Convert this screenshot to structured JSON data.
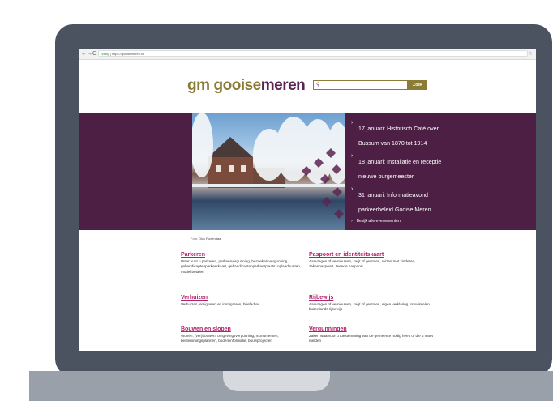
{
  "browser": {
    "back": "←",
    "forward": "→",
    "reload": "C",
    "lock": "🔒",
    "secure_label": "Veilig",
    "url": "https://gooisemeren.nl",
    "bookmark_star": "☆"
  },
  "header": {
    "logo_gm": "gm",
    "logo_name_part1": "gooise",
    "logo_name_part2": "meren",
    "search_placeholder": "",
    "search_icon": "search-icon",
    "search_button_label": "Zoek"
  },
  "hero": {
    "events": [
      {
        "label": "17 januari: Historisch Café over Bussum van 1870 tot 1914"
      },
      {
        "label": "18 januari: Installatie en receptie nieuwe burgemeester"
      },
      {
        "label": "31 januari: Informatieavond parkeerbeleid Gooise Meren"
      }
    ],
    "all_events_label": "Bekijk alle evenementen",
    "photo_caption_prefix": "Foto:",
    "photo_caption_author": "Dick Rozendaal"
  },
  "topics": [
    {
      "title": "Parkeren",
      "description": "Waar kunt u parkeren, parkeervergunning, bezoekersvergunning, gehandicaptenparkeerkaart, gehandicaptenparkeerplaats, oplaadpunten, motiel betalen"
    },
    {
      "title": "Paspoort en identiteitskaart",
      "description": "Aanvragen of vernieuwen, kwijt of gestolen, reizen met kinderen, zakenpaspoort, tweede paspoort"
    },
    {
      "title": "Verhuizen",
      "description": "Verhuizen, emigreren en immigreren, briefadres"
    },
    {
      "title": "Rijbewijs",
      "description": "Aanvragen of vernieuwen, kwijt of gestolen, eigen verklaring, omwisselen buitenlands rijbewijs"
    },
    {
      "title": "Bouwen en slopen",
      "description": "Wonen, (ver)bouwen, omgevingsvergunning, monumenten, bestemmingsplannen, bodeminformatie, bouwprojecten"
    },
    {
      "title": "Vergunningen",
      "description": "Zaken waarvoor u toestemming van de gemeente nodig heeft of die u moet melden"
    }
  ],
  "colors": {
    "brand_purple": "#4e1f45",
    "brand_gold": "#8a7b35",
    "link_magenta": "#b0226a"
  }
}
